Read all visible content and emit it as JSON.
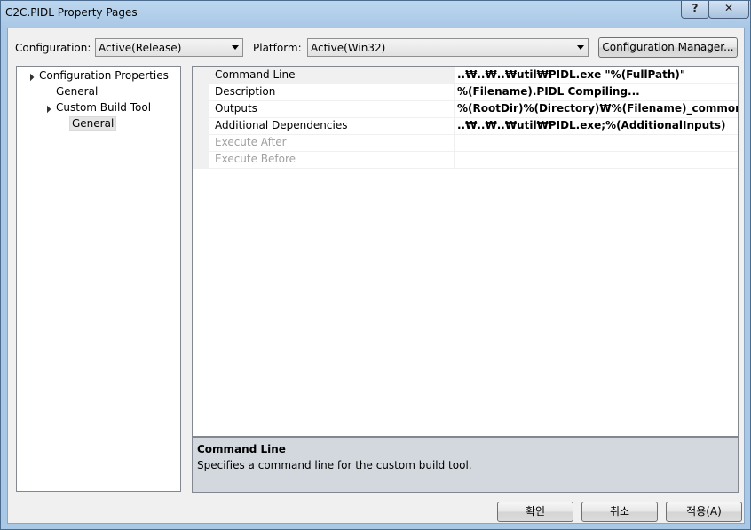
{
  "window": {
    "title": "C2C.PIDL Property Pages",
    "help_label": "?",
    "close_label": "✕"
  },
  "toolbar": {
    "configuration_label": "Configuration:",
    "configuration_value": "Active(Release)",
    "platform_label": "Platform:",
    "platform_value": "Active(Win32)",
    "config_manager_label": "Configuration Manager..."
  },
  "tree": [
    {
      "label": "Configuration Properties"
    },
    {
      "label": "General"
    },
    {
      "label": "Custom Build Tool"
    },
    {
      "label": "General",
      "selected": true
    }
  ],
  "properties": [
    {
      "name": "Command Line",
      "value": "..₩..₩..₩util₩PIDL.exe \"%(FullPath)\""
    },
    {
      "name": "Description",
      "value": "%(Filename).PIDL Compiling..."
    },
    {
      "name": "Outputs",
      "value": "%(RootDir)%(Directory)₩%(Filename)_common.cpp;%(F"
    },
    {
      "name": "Additional Dependencies",
      "value": "..₩..₩..₩util₩PIDL.exe;%(AdditionalInputs)"
    },
    {
      "name": "Execute After",
      "value": ""
    },
    {
      "name": "Execute Before",
      "value": ""
    }
  ],
  "description": {
    "title": "Command Line",
    "text": "Specifies a command line for the custom build tool."
  },
  "buttons": {
    "ok": "확인",
    "cancel": "취소",
    "apply": "적용(A)"
  }
}
